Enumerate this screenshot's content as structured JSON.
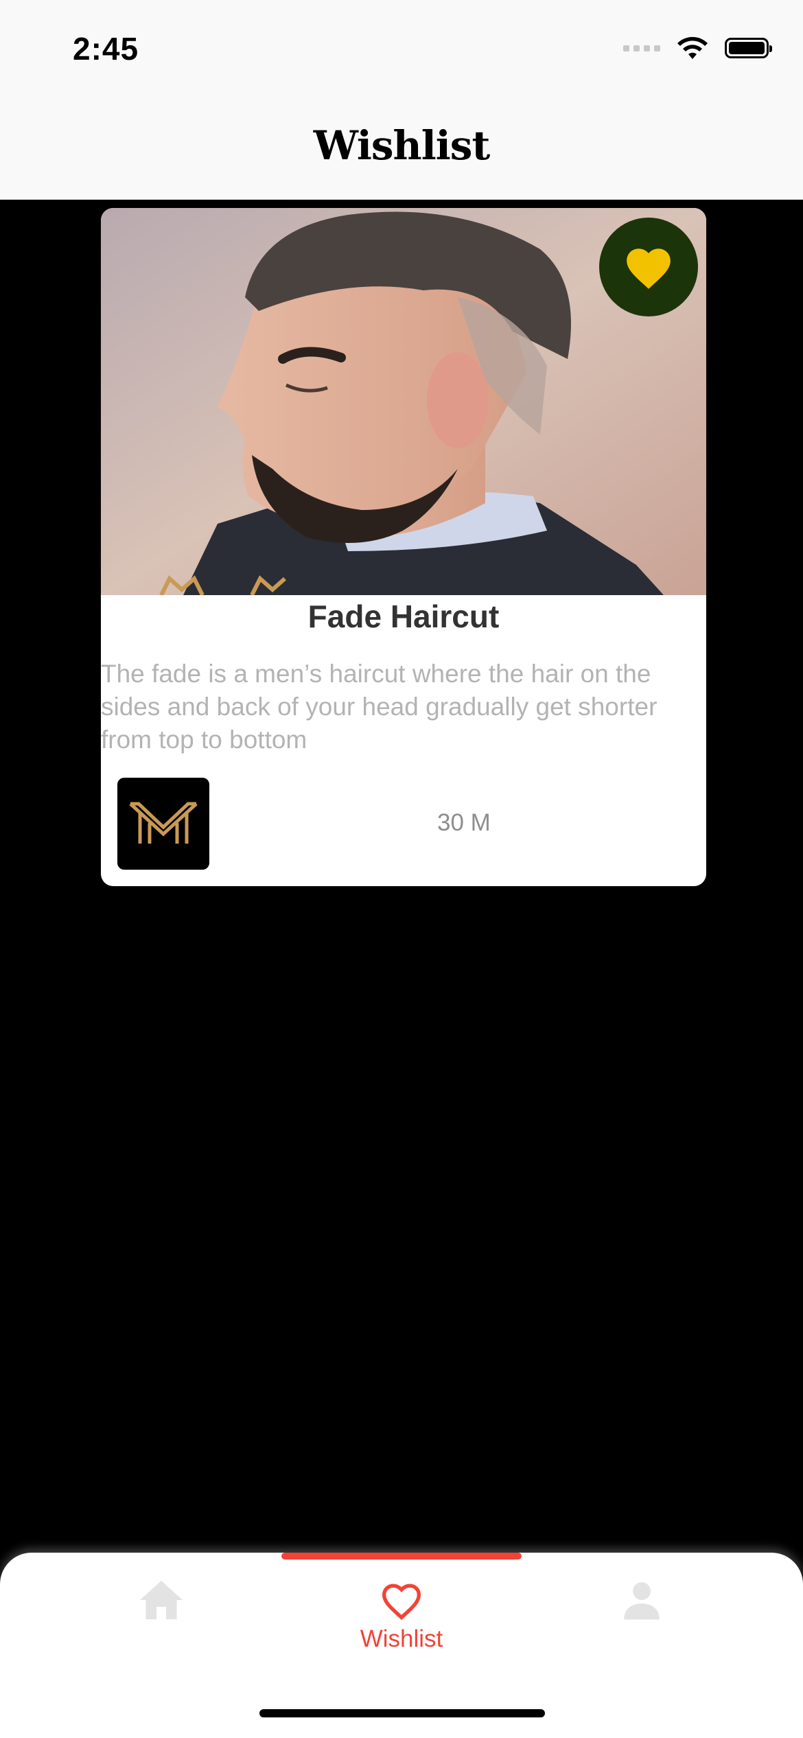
{
  "status_bar": {
    "time": "2:45"
  },
  "nav": {
    "title": "Wishlist"
  },
  "wishlist_items": [
    {
      "title": "Fade Haircut",
      "description": "The fade is a men’s haircut where the hair on the sides and back of your head gradually get shorter from top to bottom",
      "duration": "30 M",
      "favorite_icon": "heart-filled-icon",
      "shop_logo": "M-logo"
    }
  ],
  "tab_bar": {
    "tabs": [
      {
        "icon": "home-icon",
        "label": "",
        "active": false
      },
      {
        "icon": "heart-outline-icon",
        "label": "Wishlist",
        "active": true
      },
      {
        "icon": "person-icon",
        "label": "",
        "active": false
      }
    ]
  },
  "colors": {
    "accent": "#f04437",
    "favorite_button_bg": "#1c3409",
    "favorite_heart": "#f2c200",
    "logo_gold": "#c99a55",
    "background": "#000000"
  }
}
